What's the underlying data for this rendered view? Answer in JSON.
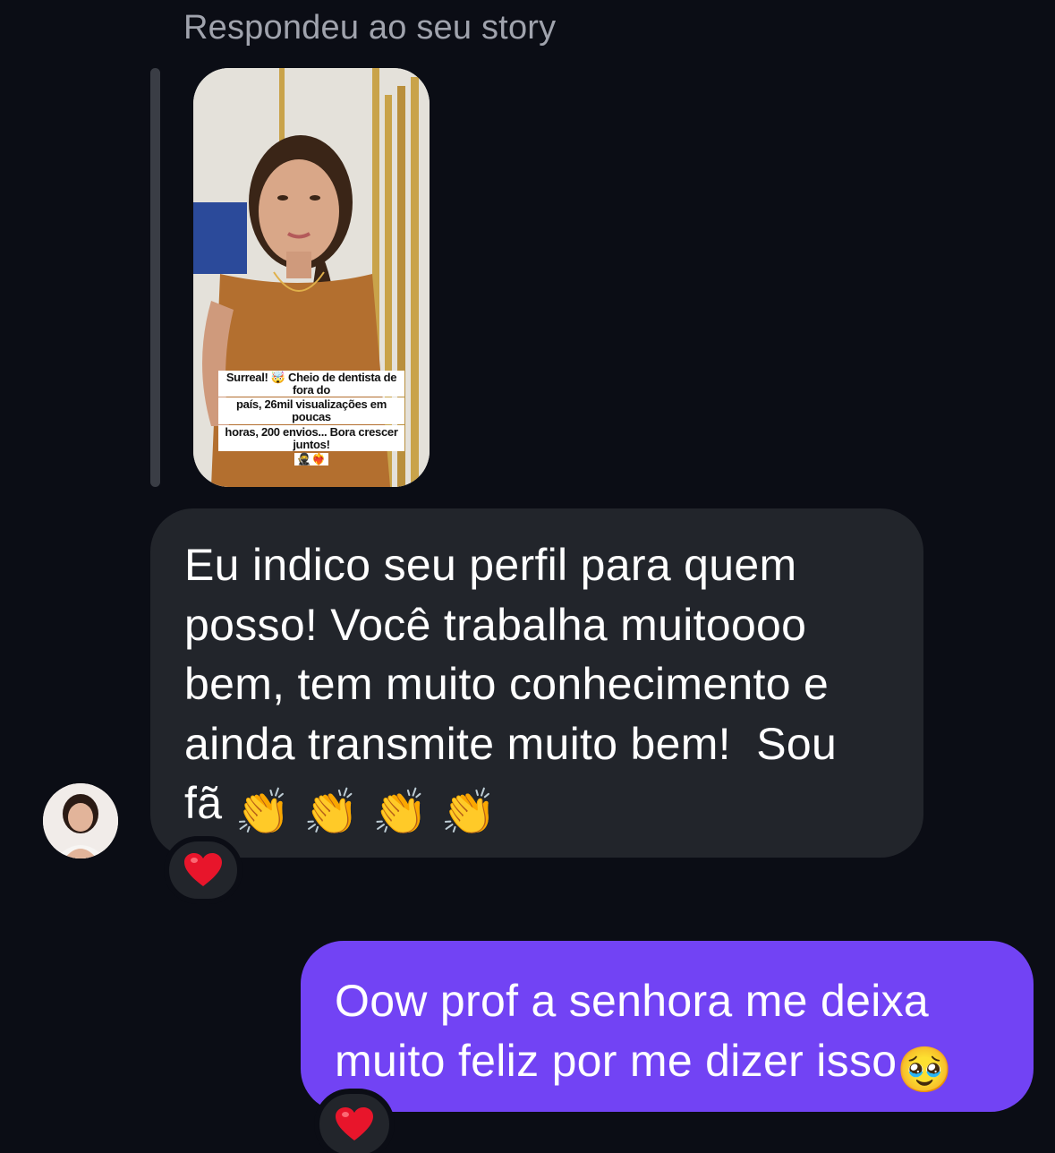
{
  "story_reply": {
    "caption": "Respondeu ao seu story",
    "thumbnail": {
      "overlay_text_lines": [
        "Surreal! 🤯 Cheio de dentista de fora do",
        "país, 26mil visualizações em poucas",
        "horas, 200 envios... Bora crescer juntos!"
      ],
      "overlay_emoji": "🥷❤️‍🔥"
    }
  },
  "messages": [
    {
      "direction": "incoming",
      "text": "Eu indico seu perfil para quem\nposso! Você trabalha muitoooo\nbem, tem muito conhecimento e\nainda transmite muito bem!  Sou\nfã ",
      "emoji_tail": [
        "👏",
        "👏",
        "👏",
        "👏"
      ],
      "reaction": "❤️"
    },
    {
      "direction": "outgoing",
      "text": "Oow prof a senhora me deixa\nmuito feliz por me dizer isso",
      "emoji_tail": "🥹",
      "reaction": "❤️"
    }
  ],
  "colors": {
    "background": "#0b0d15",
    "incoming_bubble": "#22252b",
    "outgoing_bubble": "#7243f4",
    "caption_gray": "#a0a3ad"
  },
  "icons": {
    "reaction": "heart-icon",
    "avatar": "profile-avatar"
  }
}
